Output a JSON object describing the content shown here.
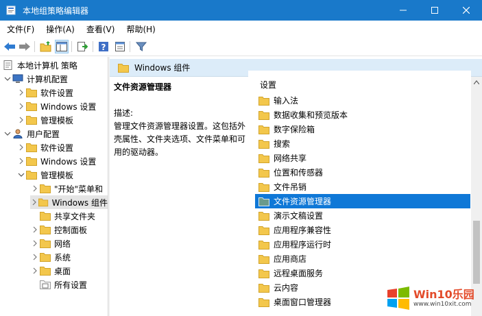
{
  "window": {
    "title": "本地组策略编辑器",
    "minimize_icon": "minimize-icon",
    "maximize_icon": "maximize-icon",
    "close_icon": "close-icon"
  },
  "menu": {
    "items": [
      "文件(F)",
      "操作(A)",
      "查看(V)",
      "帮助(H)"
    ]
  },
  "toolbar": {
    "buttons": [
      "back-icon",
      "forward-icon",
      "up-folder-icon",
      "show-hide-tree-icon",
      "export-list-icon",
      "help-icon",
      "properties-icon",
      "filter-icon"
    ]
  },
  "tree": {
    "items": [
      {
        "label": "本地计算机 策略",
        "icon": "computer-policy-icon"
      },
      {
        "label": "计算机配置",
        "icon": "computer-icon"
      },
      {
        "label": "软件设置",
        "icon": "folder-icon"
      },
      {
        "label": "Windows 设置",
        "icon": "folder-icon"
      },
      {
        "label": "管理模板",
        "icon": "folder-icon"
      },
      {
        "label": "用户配置",
        "icon": "user-icon"
      },
      {
        "label": "软件设置",
        "icon": "folder-icon"
      },
      {
        "label": "Windows 设置",
        "icon": "folder-icon"
      },
      {
        "label": "管理模板",
        "icon": "folder-icon"
      },
      {
        "label": "\"开始\"菜单和",
        "icon": "folder-icon"
      },
      {
        "label": "Windows 组件",
        "icon": "folder-icon",
        "selected": true
      },
      {
        "label": "共享文件夹",
        "icon": "folder-icon"
      },
      {
        "label": "控制面板",
        "icon": "folder-icon"
      },
      {
        "label": "网络",
        "icon": "folder-icon"
      },
      {
        "label": "系统",
        "icon": "folder-icon"
      },
      {
        "label": "桌面",
        "icon": "folder-icon"
      },
      {
        "label": "所有设置",
        "icon": "all-settings-icon"
      }
    ]
  },
  "right": {
    "header_title": "Windows 组件",
    "description": {
      "title": "文件资源管理器",
      "label": "描述:",
      "text": "管理文件资源管理器设置。这包括外壳属性、文件夹选项、文件菜单和可用的驱动器。"
    },
    "list": {
      "column_header": "设置",
      "items": [
        "输入法",
        "数据收集和预览版本",
        "数字保险箱",
        "搜索",
        "网络共享",
        "位置和传感器",
        "文件吊销",
        "文件资源管理器",
        "演示文稿设置",
        "应用程序兼容性",
        "应用程序运行时",
        "应用商店",
        "远程桌面服务",
        "云内容",
        "桌面窗口管理器"
      ],
      "selected": "文件资源管理器"
    }
  },
  "watermark": {
    "brand": "Win10乐园",
    "url": "www.win10xit.com"
  },
  "colors": {
    "titlebar": "#1979ca",
    "selection": "#0f78d7",
    "folder": "#f3c74c",
    "header_bg": "#dcecf9"
  }
}
